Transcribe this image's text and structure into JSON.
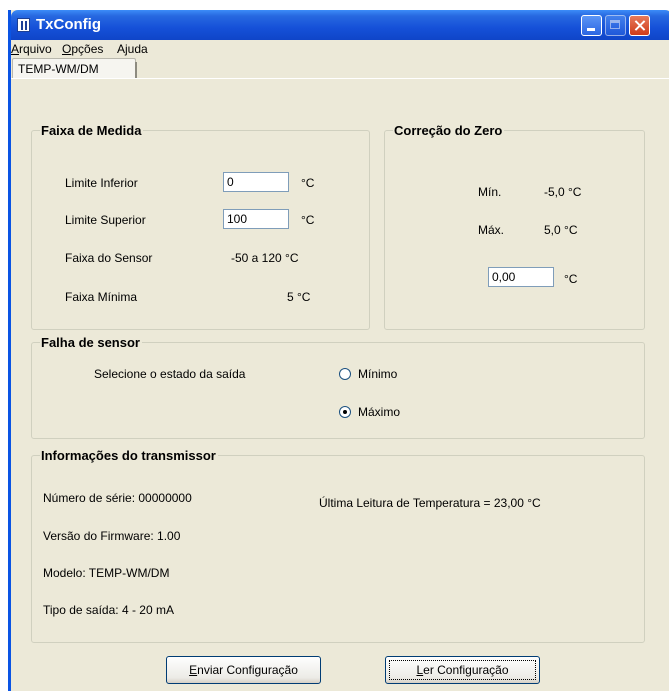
{
  "window": {
    "title": "TxConfig"
  },
  "menu": [
    {
      "accel": "A",
      "rest": "rquivo"
    },
    {
      "accel": "O",
      "rest": "pções"
    },
    {
      "accel": "",
      "rest": "Ajuda"
    }
  ],
  "tabs": [
    {
      "label": "TEMP-WM/DM"
    }
  ],
  "faixa": {
    "title": "Faixa de Medida",
    "limite_inferior": {
      "label": "Limite Inferior",
      "value": "0",
      "unit": "°C"
    },
    "limite_superior": {
      "label": "Limite Superior",
      "value": "100",
      "unit": "°C"
    },
    "faixa_sensor": {
      "label": "Faixa do Sensor",
      "value": "-50 a 120 °C"
    },
    "faixa_minima": {
      "label": "Faixa Mínima",
      "value": "5 °C"
    }
  },
  "zero": {
    "title": "Correção do Zero",
    "min_label": "Mín.",
    "min_value": "-5,0 °C",
    "max_label": "Máx.",
    "max_value": "5,0 °C",
    "value": "0,00",
    "unit": "°C"
  },
  "falha": {
    "title": "Falha de sensor",
    "prompt": "Selecione o estado da saída",
    "options": [
      {
        "label": "Mínimo",
        "checked": false
      },
      {
        "label": "Máximo",
        "checked": true
      }
    ]
  },
  "info": {
    "title": "Informações do transmissor",
    "serial": "Número de série: 00000000",
    "firmware": "Versão do Firmware: 1.00",
    "modelo": "Modelo: TEMP-WM/DM",
    "saida": "Tipo de saída: 4 - 20 mA",
    "ultima_leitura": "Última Leitura de Temperatura =  23,00 °C"
  },
  "buttons": {
    "enviar": {
      "accel": "E",
      "rest": "nviar Configuração"
    },
    "ler": {
      "accel": "L",
      "rest": "er Configuração"
    }
  }
}
